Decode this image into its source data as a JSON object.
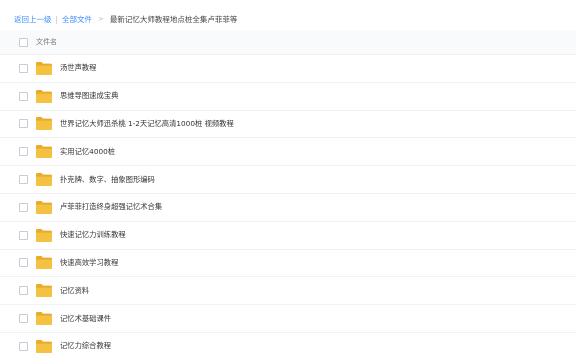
{
  "breadcrumb": {
    "back": "返回上一级",
    "separator": "|",
    "all_files": "全部文件",
    "arrow": ">",
    "current": "最新记忆大师教程地点桩全集卢菲菲等"
  },
  "table": {
    "header": "文件名",
    "rows": [
      {
        "name": "汤世声教程",
        "icon": "folder-icon"
      },
      {
        "name": "思维导图速成宝典",
        "icon": "folder-icon"
      },
      {
        "name": "世界记忆大师迅杀桃 1-2天记忆高清1000桩 视频教程",
        "icon": "folder-icon"
      },
      {
        "name": "实用记忆4000桩",
        "icon": "folder-icon"
      },
      {
        "name": "扑克牌、数字、抽象图形编码",
        "icon": "folder-icon"
      },
      {
        "name": "卢菲菲打造终身超强记忆术合集",
        "icon": "folder-icon"
      },
      {
        "name": "快速记忆力训练教程",
        "icon": "folder-icon"
      },
      {
        "name": "快速高效学习教程",
        "icon": "folder-icon"
      },
      {
        "name": "记忆资料",
        "icon": "folder-icon"
      },
      {
        "name": "记忆术基础课件",
        "icon": "folder-icon"
      },
      {
        "name": "记忆力综合教程",
        "icon": "folder-icon"
      }
    ]
  },
  "colors": {
    "link": "#3b8cff",
    "folder": "#f5c141",
    "folder_dark": "#e8ab2a"
  }
}
